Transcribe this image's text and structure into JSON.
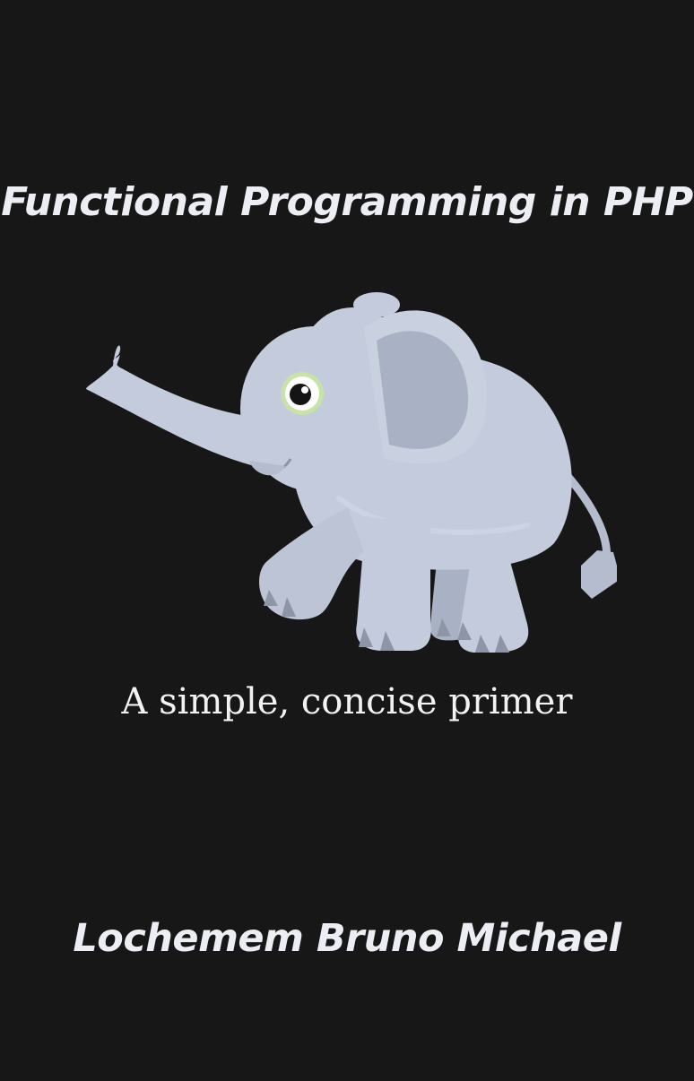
{
  "cover": {
    "title": "Functional Programming in PHP",
    "subtitle": "A simple, concise primer",
    "author": "Lochemem Bruno Michael",
    "illustration": "elephant-icon",
    "colors": {
      "background": "#171717",
      "text": "#eceef4",
      "elephant_body": "#c3cbdc",
      "elephant_shade": "#a9b1c4",
      "eye_ring": "#c8e3a8"
    }
  }
}
